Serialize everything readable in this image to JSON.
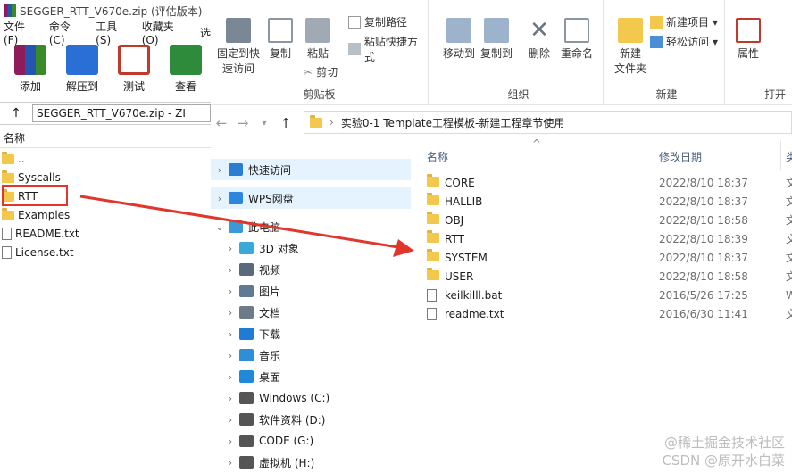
{
  "winrar": {
    "title": "SEGGER_RTT_V670e.zip (评估版本)",
    "menu": [
      "文件(F)",
      "命令(C)",
      "工具(S)",
      "收藏夹(O)",
      "选"
    ],
    "tools": [
      {
        "label": "添加",
        "icon": "add-archive-icon",
        "color": "#b0306a"
      },
      {
        "label": "解压到",
        "icon": "extract-folder-icon",
        "color": "#2a6fd6"
      },
      {
        "label": "测试",
        "icon": "test-clipboard-icon",
        "color": "#c0392b"
      },
      {
        "label": "查看",
        "icon": "view-book-icon",
        "color": "#2e8b3b"
      }
    ],
    "address": "SEGGER_RTT_V670e.zip - ZI",
    "column_name": "名称",
    "files": [
      {
        "name": "..",
        "type": "folder"
      },
      {
        "name": "Syscalls",
        "type": "folder"
      },
      {
        "name": "RTT",
        "type": "folder"
      },
      {
        "name": "Examples",
        "type": "folder"
      },
      {
        "name": "README.txt",
        "type": "file"
      },
      {
        "name": "License.txt",
        "type": "file"
      }
    ]
  },
  "ribbon": {
    "pin": "固定到快\n速访问",
    "copy": "复制",
    "paste": "粘贴",
    "copy_path": "复制路径",
    "paste_shortcut": "粘贴快捷方式",
    "cut": "剪切",
    "clipboard_group": "剪贴板",
    "move_to": "移动到",
    "copy_to": "复制到",
    "delete": "删除",
    "rename": "重命名",
    "organize_group": "组织",
    "new_folder": "新建\n文件夹",
    "new_item": "新建项目",
    "easy_access": "轻松访问",
    "new_group": "新建",
    "properties": "属性",
    "open_group": "打开"
  },
  "breadcrumb": "实验0-1 Template工程模板-新建工程章节使用",
  "nav": [
    {
      "label": "快速访问",
      "icon": "star-icon",
      "color": "#2b7cd3"
    },
    {
      "label": "WPS网盘",
      "icon": "cloud-icon",
      "color": "#2b86e0"
    },
    {
      "label": "此电脑",
      "icon": "computer-icon",
      "color": "#3a9ad9"
    },
    {
      "label": "3D 对象",
      "icon": "3d-objects-icon",
      "color": "#39a9d8"
    },
    {
      "label": "视频",
      "icon": "video-icon",
      "color": "#5b6a7a"
    },
    {
      "label": "图片",
      "icon": "picture-icon",
      "color": "#5f7a92"
    },
    {
      "label": "文档",
      "icon": "document-icon",
      "color": "#6d7a87"
    },
    {
      "label": "下载",
      "icon": "download-icon",
      "color": "#1f7bd4"
    },
    {
      "label": "音乐",
      "icon": "music-icon",
      "color": "#2d8fd8"
    },
    {
      "label": "桌面",
      "icon": "desktop-icon",
      "color": "#1f8ad8"
    },
    {
      "label": "Windows (C:)",
      "icon": "drive-icon",
      "color": "#555"
    },
    {
      "label": "软件资料 (D:)",
      "icon": "drive-icon",
      "color": "#555"
    },
    {
      "label": "CODE (G:)",
      "icon": "drive-icon",
      "color": "#555"
    },
    {
      "label": "虚拟机 (H:)",
      "icon": "drive-icon",
      "color": "#555"
    }
  ],
  "columns": {
    "name": "名称",
    "date": "修改日期",
    "type": "类"
  },
  "files": [
    {
      "name": "CORE",
      "date": "2022/8/10 18:37",
      "type": "文",
      "kind": "folder"
    },
    {
      "name": "HALLIB",
      "date": "2022/8/10 18:37",
      "type": "文",
      "kind": "folder"
    },
    {
      "name": "OBJ",
      "date": "2022/8/10 18:58",
      "type": "文",
      "kind": "folder"
    },
    {
      "name": "RTT",
      "date": "2022/8/10 18:39",
      "type": "文",
      "kind": "folder"
    },
    {
      "name": "SYSTEM",
      "date": "2022/8/10 18:37",
      "type": "文",
      "kind": "folder"
    },
    {
      "name": "USER",
      "date": "2022/8/10 18:58",
      "type": "文",
      "kind": "folder"
    },
    {
      "name": "keilkilll.bat",
      "date": "2016/5/26 17:25",
      "type": "W",
      "kind": "bat"
    },
    {
      "name": "readme.txt",
      "date": "2016/6/30 11:41",
      "type": "文",
      "kind": "txt"
    }
  ],
  "watermark": "CSDN @原开水白菜",
  "watermark2": "@稀土掘金技术社区",
  "arrow_color": "#e0362c"
}
